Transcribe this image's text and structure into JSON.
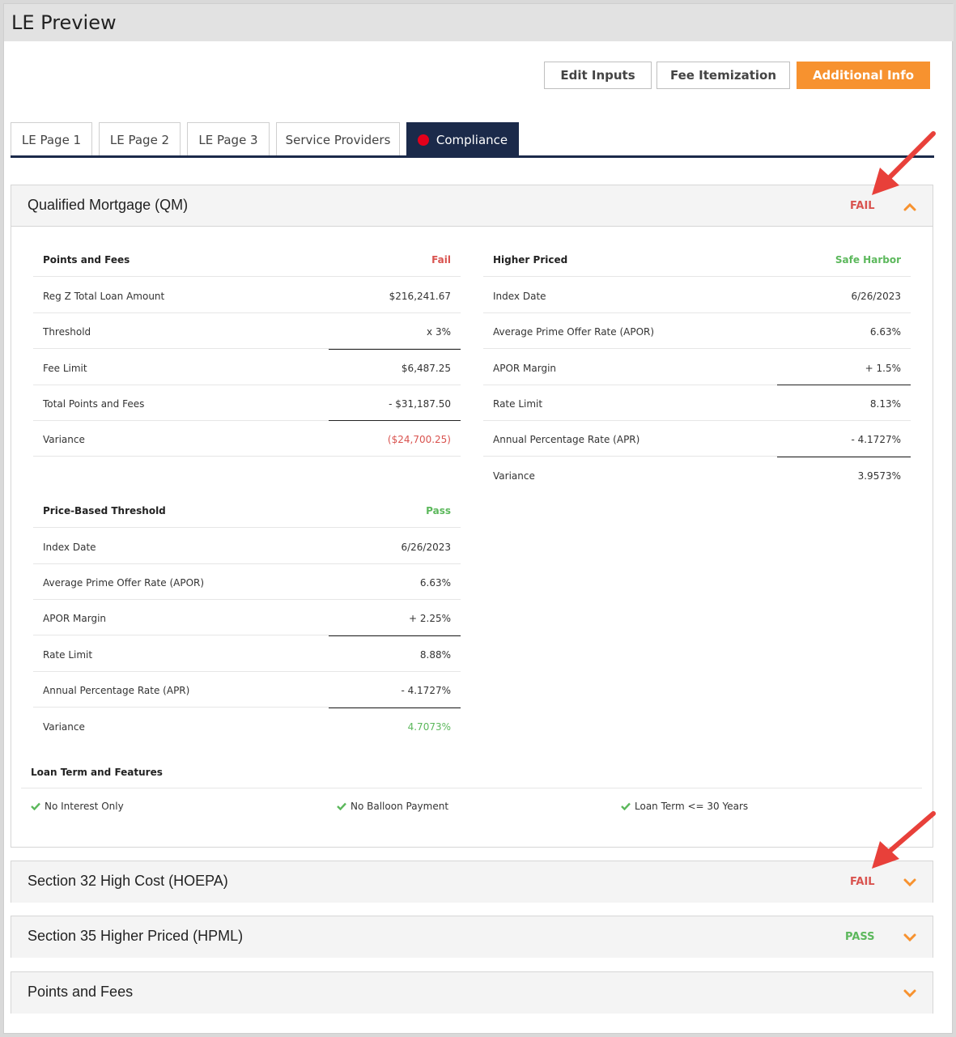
{
  "window": {
    "title": "LE Preview"
  },
  "toolbar": {
    "edit_inputs": "Edit Inputs",
    "fee_itemization": "Fee Itemization",
    "additional_info": "Additional Info",
    "accent_color": "#f7922f"
  },
  "tabs": [
    {
      "label": "LE Page 1"
    },
    {
      "label": "LE Page 2"
    },
    {
      "label": "LE Page 3"
    },
    {
      "label": "Service Providers"
    },
    {
      "label": "Compliance",
      "active": true,
      "indicator": "red-dot-icon"
    }
  ],
  "qm": {
    "title": "Qualified Mortgage (QM)",
    "status": "FAIL",
    "points_and_fees": {
      "title": "Points and Fees",
      "status": "Fail",
      "rows": [
        {
          "label": "Reg Z Total Loan Amount",
          "value": "$216,241.67"
        },
        {
          "label": "Threshold",
          "value": "x 3%"
        },
        {
          "label": "Fee Limit",
          "value": "$6,487.25"
        },
        {
          "label": "Total Points and Fees",
          "value": "- $31,187.50"
        },
        {
          "label": "Variance",
          "value": "($24,700.25)"
        }
      ]
    },
    "higher_priced": {
      "title": "Higher Priced",
      "status": "Safe Harbor",
      "rows": [
        {
          "label": "Index Date",
          "value": "6/26/2023"
        },
        {
          "label": "Average Prime Offer Rate (APOR)",
          "value": "6.63%"
        },
        {
          "label": "APOR Margin",
          "value": "+ 1.5%"
        },
        {
          "label": "Rate Limit",
          "value": "8.13%"
        },
        {
          "label": "Annual Percentage Rate (APR)",
          "value": "- 4.1727%"
        },
        {
          "label": "Variance",
          "value": "3.9573%"
        }
      ]
    },
    "price_based": {
      "title": "Price-Based Threshold",
      "status": "Pass",
      "rows": [
        {
          "label": "Index Date",
          "value": "6/26/2023"
        },
        {
          "label": "Average Prime Offer Rate (APOR)",
          "value": "6.63%"
        },
        {
          "label": "APOR Margin",
          "value": "+ 2.25%"
        },
        {
          "label": "Rate Limit",
          "value": "8.88%"
        },
        {
          "label": "Annual Percentage Rate (APR)",
          "value": "- 4.1727%"
        },
        {
          "label": "Variance",
          "value": "4.7073%"
        }
      ]
    },
    "loan_term": {
      "title": "Loan Term and Features",
      "features": [
        {
          "label": "No Interest Only",
          "icon": "check-icon"
        },
        {
          "label": "No Balloon Payment",
          "icon": "check-icon"
        },
        {
          "label": "Loan Term <= 30 Years",
          "icon": "check-icon"
        }
      ]
    }
  },
  "sections": [
    {
      "title": "Section 32 High Cost (HOEPA)",
      "status": "FAIL"
    },
    {
      "title": "Section 35 Higher Priced (HPML)",
      "status": "PASS"
    },
    {
      "title": "Points and Fees",
      "status": ""
    }
  ],
  "colors": {
    "fail": "#d9534f",
    "pass": "#5cb85c",
    "tab_active": "#1b2a4a",
    "arrow": "#e8403a"
  }
}
